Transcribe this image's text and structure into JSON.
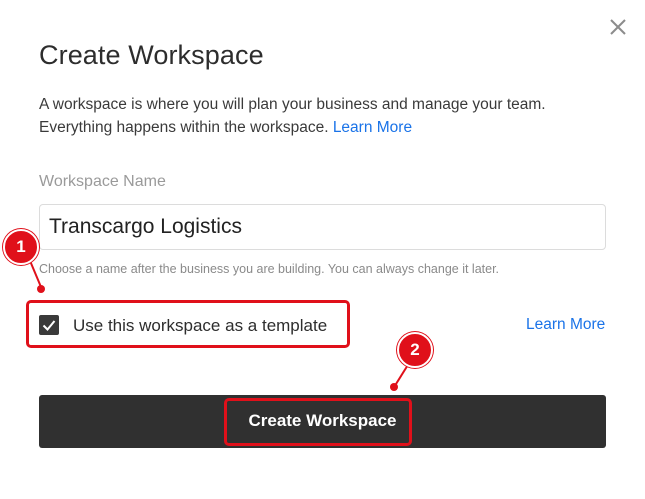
{
  "dialog": {
    "title": "Create Workspace",
    "description": "A workspace is where you will plan your business and manage your team. Everything happens within the workspace.",
    "description_link": "Learn More",
    "field_label": "Workspace Name",
    "field_value": "Transcargo Logistics",
    "hint": "Choose a name after the business you are building. You can always change it later.",
    "template_checkbox_label": "Use this workspace as a template",
    "template_checked": true,
    "template_learn_more": "Learn More",
    "create_button_label": "Create Workspace",
    "close_icon": "close-icon"
  },
  "annotations": {
    "marker_1": "1",
    "marker_2": "2"
  },
  "colors": {
    "accent_link": "#1a73e8",
    "button_bg": "#303030",
    "highlight_red": "#e0101a"
  }
}
